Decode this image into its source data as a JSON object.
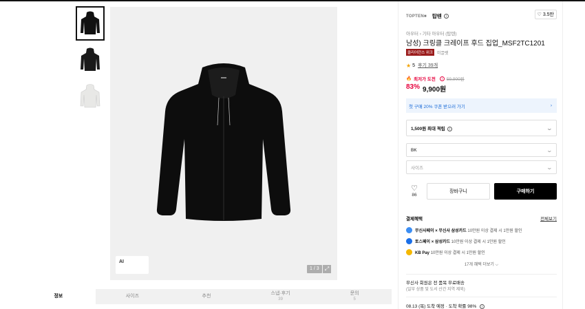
{
  "gallery": {
    "ai_label": "AI",
    "pager": "1 / 3",
    "expand_icon": "expand-icon"
  },
  "tabs": [
    {
      "label": "정보",
      "count": ""
    },
    {
      "label": "사이즈",
      "count": ""
    },
    {
      "label": "추천",
      "count": ""
    },
    {
      "label": "스냅·후기",
      "count": "39"
    },
    {
      "label": "문의",
      "count": "5"
    }
  ],
  "product": {
    "brand_logo": "TOPTEN■",
    "brand": "탑텐",
    "likes": "3.5만",
    "breadcrumb": "아우터 › 기타 아우터 (탑텐)",
    "title": "남성) 크링클 크레이프 후드 집업_MSF2TC1201",
    "badge": "클리어런스 위크",
    "badge_note": "미끌렛",
    "rating": "5",
    "reviews": "후기 39개",
    "lowest_label": "최저가 도전",
    "original_price": "59,900원",
    "discount": "83%",
    "price": "9,900원",
    "coupon": "첫 구매 20% 쿠폰 받으러 가기",
    "points": "1,500원 최대 적립",
    "color_value": "BK",
    "size_placeholder": "사이즈",
    "wish_count": "86",
    "cart": "장바구니",
    "buy": "구매하기"
  },
  "benefits": {
    "title": "결제혜택",
    "all": "전체보기",
    "items": [
      {
        "name": "무신사페이 × 무신사 삼성카드",
        "text": "10만원 이상 결제 시 1만원 할인",
        "color": "#3c8ef3"
      },
      {
        "name": "토스페이 × 삼성카드",
        "text": "10만원 이상 결제 시 1만원 할인",
        "color": "#1a6fe8"
      },
      {
        "name": "KB Pay",
        "text": "10만원 이상 결제 시 1만원 할인",
        "color": "#f5b800"
      }
    ],
    "more": "17개 혜택 더보기 ⌵"
  },
  "shipping": {
    "line1": "무신사 회원은 전 품목 무료배송",
    "line2": "(일부 상품 및 도서 산간 지역 제외)",
    "arrival": "08.13 (목) 도착 예정 · 도착 확률 98%"
  }
}
